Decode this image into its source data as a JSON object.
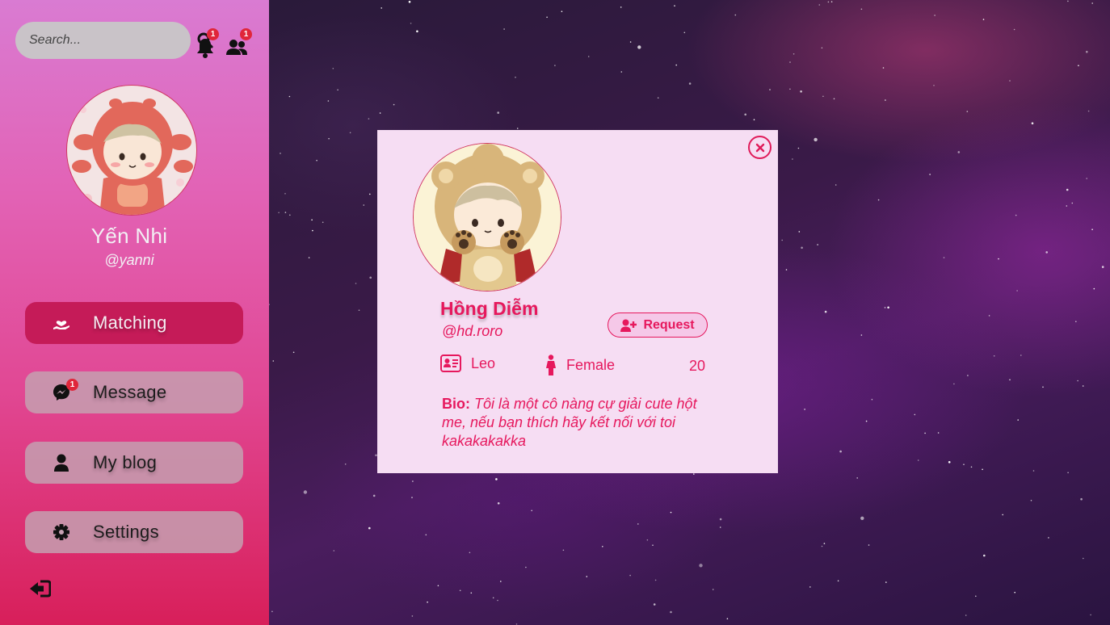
{
  "search": {
    "placeholder": "Search..."
  },
  "notifications": {
    "bell_badge": "1",
    "friends_badge": "1"
  },
  "user": {
    "name": "Yến Nhi",
    "handle": "@yanni"
  },
  "nav": {
    "items": [
      {
        "label": "Matching",
        "icon": "hand-heart-icon",
        "active": true
      },
      {
        "label": "Message",
        "icon": "messenger-icon",
        "badge": "1"
      },
      {
        "label": "My blog",
        "icon": "user-icon"
      },
      {
        "label": "Settings",
        "icon": "gear-icon"
      }
    ]
  },
  "profile": {
    "name": "Hồng Diễm",
    "handle": "@hd.roro",
    "request_label": "Request",
    "zodiac": "Leo",
    "gender": "Female",
    "age": "20",
    "bio_label": "Bio:",
    "bio_text": "Tôi là một cô nàng cự giải cute hột me, nếu bạn thích hãy kết nối với toi kakakakakka"
  },
  "colors": {
    "accent": "#e6185d",
    "modal_bg": "#f6ddf3",
    "active_nav": "#c51b58"
  }
}
